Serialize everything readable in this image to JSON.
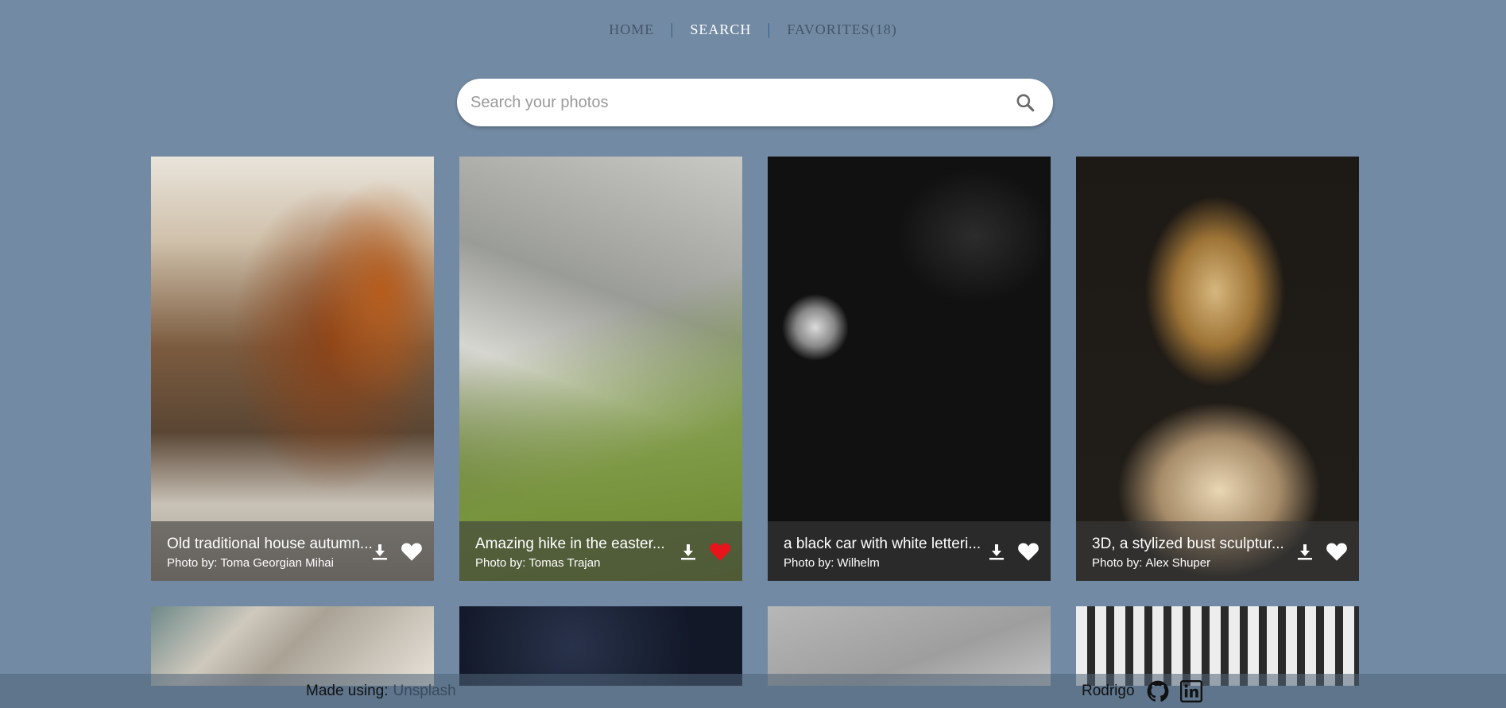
{
  "nav": {
    "home": "HOME",
    "separator": "|",
    "search": "SEARCH",
    "favorites": "FAVORITES(18)"
  },
  "search": {
    "placeholder": "Search your photos",
    "icon": "search-icon"
  },
  "photos": [
    {
      "title": "Old traditional house autumn...",
      "author_label": "Photo by:",
      "author": "Toma Georgian Mihai",
      "favorited": false
    },
    {
      "title": "Amazing hike in the easter...",
      "author_label": "Photo by:",
      "author": "Tomas Trajan",
      "favorited": true
    },
    {
      "title": "a black car with white letteri...",
      "author_label": "Photo by:",
      "author": "Wilhelm",
      "favorited": false
    },
    {
      "title": "3D, a stylized bust sculptur...",
      "author_label": "Photo by:",
      "author": "Alex Shuper",
      "favorited": false
    }
  ],
  "colors": {
    "background": "#728aa3",
    "favorite_active": "#e8141b",
    "favorite_inactive": "#ffffff"
  },
  "footer": {
    "made_using": "Made using:",
    "unsplash": "Unsplash",
    "author": "Rodrigo",
    "icons": [
      "github-icon",
      "linkedin-icon"
    ]
  }
}
